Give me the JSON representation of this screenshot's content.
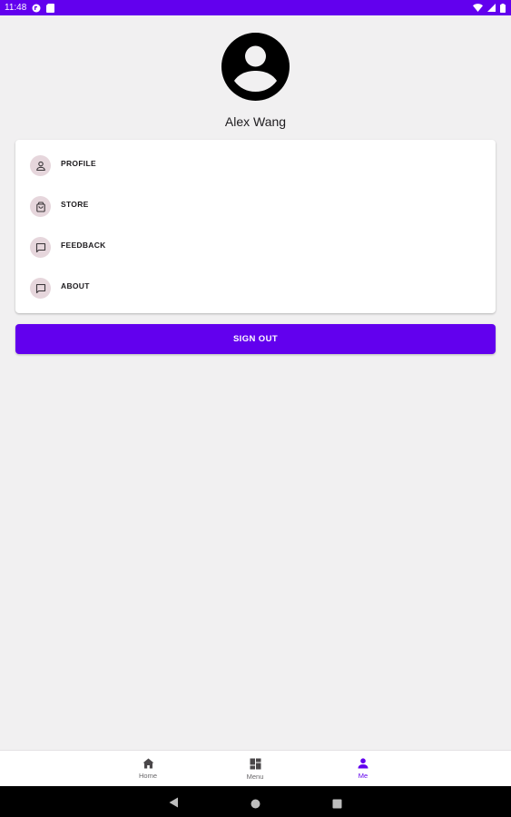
{
  "status_bar": {
    "time": "11:48"
  },
  "user": {
    "name": "Alex Wang"
  },
  "menu": {
    "items": [
      {
        "label": "PROFILE",
        "icon": "person-outline-icon"
      },
      {
        "label": "STORE",
        "icon": "shopping-bag-icon"
      },
      {
        "label": "FEEDBACK",
        "icon": "chat-bubble-icon"
      },
      {
        "label": "ABOUT",
        "icon": "chat-bubble-icon"
      }
    ]
  },
  "sign_out": {
    "label": "SIGN OUT"
  },
  "bottom_nav": {
    "items": [
      {
        "label": "Home",
        "icon": "home-icon",
        "active": false
      },
      {
        "label": "Menu",
        "icon": "dashboard-icon",
        "active": false
      },
      {
        "label": "Me",
        "icon": "person-icon",
        "active": true
      }
    ]
  },
  "colors": {
    "primary": "#6200ee",
    "background": "#f1f0f1",
    "icon_chip": "#e6d6dc"
  }
}
